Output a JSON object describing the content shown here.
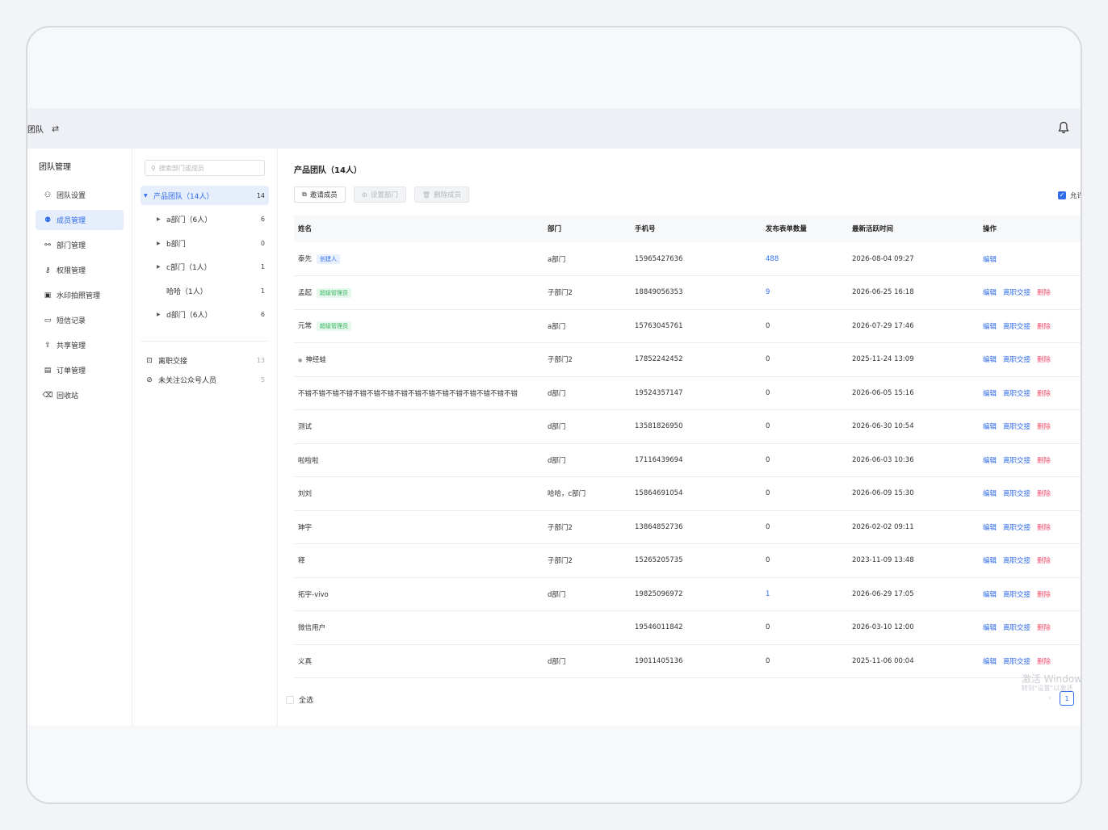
{
  "header": {
    "team_name": "团队",
    "switch_icon": "swap-icon",
    "bell_icon": "bell-icon"
  },
  "sidebar": {
    "title": "团队管理",
    "items": [
      {
        "label": "团队设置",
        "icon": "team-settings-icon"
      },
      {
        "label": "成员管理",
        "icon": "member-icon",
        "active": true
      },
      {
        "label": "部门管理",
        "icon": "org-chart-icon"
      },
      {
        "label": "权限管理",
        "icon": "permission-icon"
      },
      {
        "label": "水印拍照管理",
        "icon": "watermark-photo-icon"
      },
      {
        "label": "短信记录",
        "icon": "message-icon"
      },
      {
        "label": "共享管理",
        "icon": "share-icon"
      },
      {
        "label": "订单管理",
        "icon": "order-icon"
      },
      {
        "label": "回收站",
        "icon": "trash-icon"
      }
    ]
  },
  "tree": {
    "search_placeholder": "搜索部门或成员",
    "root": {
      "label": "产品团队（14人）",
      "count": "14"
    },
    "children": [
      {
        "label": "a部门（6人）",
        "count": "6",
        "expandable": true
      },
      {
        "label": "b部门",
        "count": "0",
        "expandable": true
      },
      {
        "label": "c部门（1人）",
        "count": "1",
        "expandable": true
      },
      {
        "label": "哈哈（1人）",
        "count": "1",
        "expandable": false
      },
      {
        "label": "d部门（6人）",
        "count": "6",
        "expandable": true
      }
    ],
    "extras": [
      {
        "label": "离职交接",
        "count": "13"
      },
      {
        "label": "未关注公众号人员",
        "count": "5"
      }
    ]
  },
  "main": {
    "title": "产品团队（14人）",
    "buttons": {
      "invite": "邀请成员",
      "set_dept": "设置部门",
      "delete": "删除成员"
    },
    "allow_label": "允许",
    "columns": [
      "姓名",
      "部门",
      "手机号",
      "发布表单数量",
      "最新活跃时间",
      "操作"
    ],
    "ops": {
      "edit": "编辑",
      "handover": "离职交接",
      "delete": "删除"
    },
    "rows": [
      {
        "name": "泰先",
        "tag": "创建人",
        "tag_color": "blue",
        "dept": "a部门",
        "phone": "15965427636",
        "forms": "488",
        "forms_link": true,
        "active": "2026-08-04 09:27",
        "creator": true
      },
      {
        "name": "孟起",
        "tag": "超级管理员",
        "tag_color": "green",
        "dept": "子部门2",
        "phone": "18849056353",
        "forms": "9",
        "forms_link": true,
        "active": "2026-06-25 16:18"
      },
      {
        "name": "元常",
        "tag": "超级管理员",
        "tag_color": "green",
        "dept": "a部门",
        "phone": "15763045761",
        "forms": "0",
        "active": "2026-07-29 17:46"
      },
      {
        "name": "神经蛙",
        "bullet": true,
        "dept": "子部门2",
        "phone": "17852242452",
        "forms": "0",
        "active": "2025-11-24 13:09"
      },
      {
        "name": "不错不错不错不错不错不错不错不错不错不错不错不错不错不错不错不错",
        "dept": "d部门",
        "phone": "19524357147",
        "forms": "0",
        "active": "2026-06-05 15:16"
      },
      {
        "name": "测试",
        "dept": "d部门",
        "phone": "13581826950",
        "forms": "0",
        "active": "2026-06-30 10:54"
      },
      {
        "name": "啦啦啦",
        "dept": "d部门",
        "phone": "17116439694",
        "forms": "0",
        "active": "2026-06-03 10:36"
      },
      {
        "name": "刘刘",
        "dept": "哈哈，c部门",
        "phone": "15864691054",
        "forms": "0",
        "active": "2026-06-09 15:30"
      },
      {
        "name": "珅宇",
        "dept": "子部门2",
        "phone": "13864852736",
        "forms": "0",
        "active": "2026-02-02 09:11"
      },
      {
        "name": "释",
        "dept": "子部门2",
        "phone": "15265205735",
        "forms": "0",
        "active": "2023-11-09 13:48"
      },
      {
        "name": "拓宇-vivo",
        "dept": "d部门",
        "phone": "19825096972",
        "forms": "1",
        "forms_link": true,
        "active": "2026-06-29 17:05"
      },
      {
        "name": "微信用户",
        "dept": "",
        "phone": "19546011842",
        "forms": "0",
        "active": "2026-03-10 12:00"
      },
      {
        "name": "义真",
        "dept": "d部门",
        "phone": "19011405136",
        "forms": "0",
        "active": "2025-11-06 00:04"
      }
    ],
    "select_all": "全选",
    "watermark_line1": "激活 Window",
    "watermark_line2": "转到\"设置\"以激活",
    "page": "1"
  }
}
